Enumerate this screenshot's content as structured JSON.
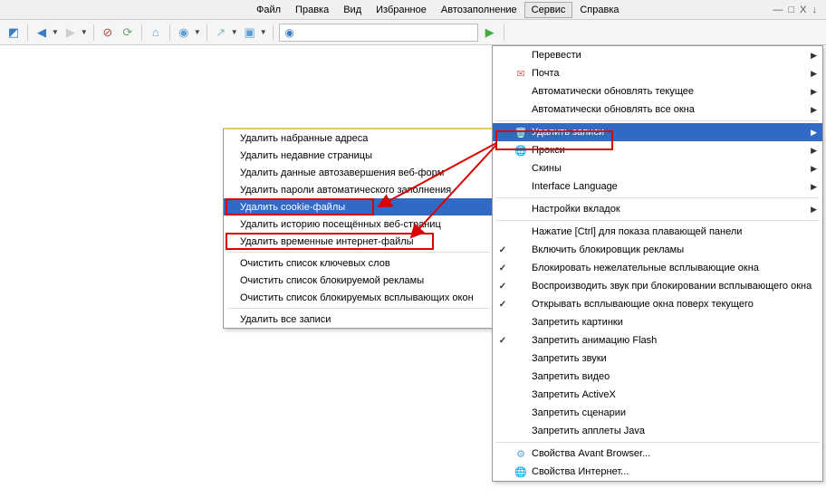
{
  "menubar": {
    "items": [
      "Файл",
      "Правка",
      "Вид",
      "Избранное",
      "Автозаполнение",
      "Сервис",
      "Справка"
    ],
    "active_index": 5
  },
  "dropdown": {
    "items": [
      {
        "label": "Перевести",
        "icon": "",
        "check": "",
        "submenu": true
      },
      {
        "label": "Почта",
        "icon": "✉",
        "check": "",
        "submenu": true,
        "icon_color": "#d66"
      },
      {
        "label": "Автоматически обновлять текущее",
        "icon": "",
        "check": "",
        "submenu": true
      },
      {
        "label": "Автоматически обновлять все окна",
        "icon": "",
        "check": "",
        "submenu": true
      },
      {
        "sep": true
      },
      {
        "label": "Удалить записи",
        "icon": "🗑",
        "check": "",
        "submenu": true,
        "highlight": true,
        "icon_color": "#cfe"
      },
      {
        "label": "Прокси",
        "icon": "🌐",
        "check": "",
        "submenu": true,
        "icon_color": "#6b6"
      },
      {
        "label": "Скины",
        "icon": "",
        "check": "",
        "submenu": true
      },
      {
        "label": "Interface Language",
        "icon": "",
        "check": "",
        "submenu": true
      },
      {
        "sep": true
      },
      {
        "label": "Настройки вкладок",
        "icon": "",
        "check": "",
        "submenu": true
      },
      {
        "sep": true
      },
      {
        "label": "Нажатие [Ctrl] для показа плавающей панели",
        "icon": "",
        "check": ""
      },
      {
        "label": "Включить блокировщик рекламы",
        "icon": "",
        "check": "on"
      },
      {
        "label": "Блокировать нежелательные всплывающие окна",
        "icon": "",
        "check": "on"
      },
      {
        "label": "Воспроизводить звук при блокировании всплывающего окна",
        "icon": "",
        "check": "on"
      },
      {
        "label": "Открывать всплывающие окна поверх текущего",
        "icon": "",
        "check": "on"
      },
      {
        "label": "Запретить картинки",
        "icon": "",
        "check": ""
      },
      {
        "label": "Запретить анимацию Flash",
        "icon": "",
        "check": "on"
      },
      {
        "label": "Запретить звуки",
        "icon": "",
        "check": ""
      },
      {
        "label": "Запретить видео",
        "icon": "",
        "check": ""
      },
      {
        "label": "Запретить ActiveX",
        "icon": "",
        "check": ""
      },
      {
        "label": "Запретить сценарии",
        "icon": "",
        "check": ""
      },
      {
        "label": "Запретить апплеты Java",
        "icon": "",
        "check": ""
      },
      {
        "sep": true
      },
      {
        "label": "Свойства Avant Browser...",
        "icon": "⚙",
        "check": "",
        "icon_color": "#5aa0d8"
      },
      {
        "label": "Свойства Интернет...",
        "icon": "🌐",
        "check": "",
        "icon_color": "#5aa0d8"
      }
    ]
  },
  "submenu": {
    "items": [
      {
        "label": "Удалить набранные адреса"
      },
      {
        "label": "Удалить недавние страницы"
      },
      {
        "label": "Удалить данные автозавершения веб-форм"
      },
      {
        "label": "Удалить пароли автоматического заполнения"
      },
      {
        "label": "Удалить cookie-файлы",
        "highlight": true
      },
      {
        "label": "Удалить историю посещённых веб-страниц"
      },
      {
        "label": "Удалить временные интернет-файлы"
      },
      {
        "sep": true
      },
      {
        "label": "Очистить список ключевых слов"
      },
      {
        "label": "Очистить список блокируемой рекламы"
      },
      {
        "label": "Очистить список блокируемых всплывающих окон"
      },
      {
        "sep": true
      },
      {
        "label": "Удалить все записи"
      }
    ]
  }
}
